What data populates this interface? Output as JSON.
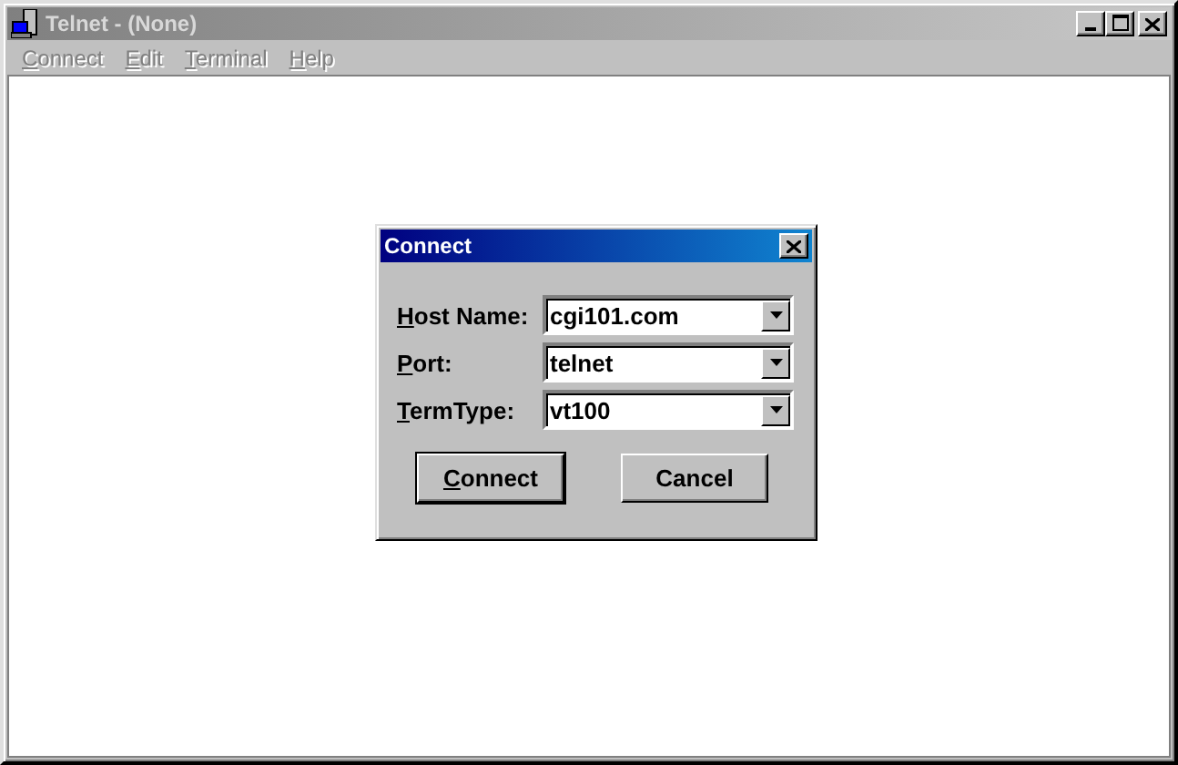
{
  "window": {
    "title": "Telnet - (None)",
    "active": false
  },
  "menu": [
    {
      "label": "Connect",
      "underline_first": true,
      "disabled": true
    },
    {
      "label": "Edit",
      "underline_first": true,
      "disabled": true
    },
    {
      "label": "Terminal",
      "underline_first": true,
      "disabled": true
    },
    {
      "label": "Help",
      "underline_first": true,
      "disabled": true
    }
  ],
  "dialog": {
    "title": "Connect",
    "active": true,
    "fields": [
      {
        "label": "Host Name:",
        "underline_first": true,
        "value": "cgi101.com"
      },
      {
        "label": "Port:",
        "underline_first": true,
        "value": "telnet"
      },
      {
        "label": "TermType:",
        "underline_first": true,
        "value": "vt100"
      }
    ],
    "buttons": [
      {
        "label": "Connect",
        "underline_first": true,
        "default": true
      },
      {
        "label": "Cancel",
        "underline_first": false,
        "default": false
      }
    ]
  }
}
